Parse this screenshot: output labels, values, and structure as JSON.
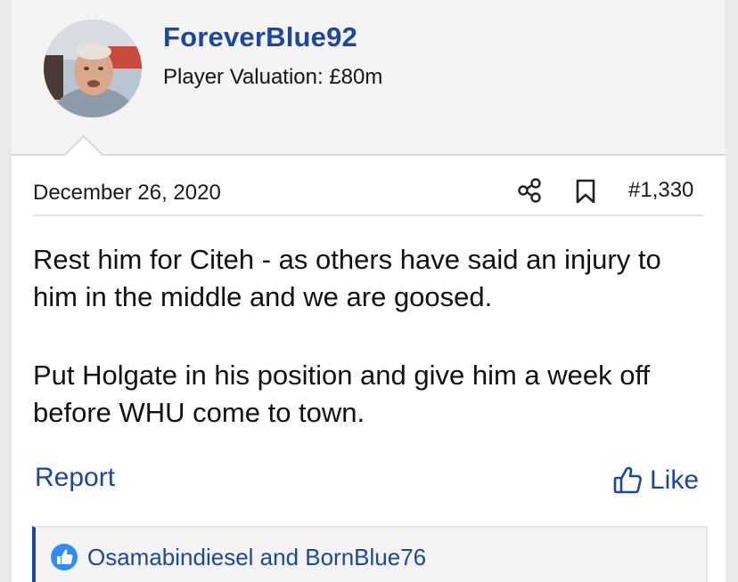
{
  "user": {
    "username": "ForeverBlue92",
    "valuation": "Player Valuation: £80m"
  },
  "post": {
    "date": "December 26, 2020",
    "number": "#1,330",
    "paragraphs": [
      "Rest him for Citeh - as others have said an injury to him in the middle and we are goosed.",
      "Put Holgate in his position and give him a week off before WHU come to town."
    ]
  },
  "actions": {
    "report_label": "Report",
    "like_label": "Like"
  },
  "reactions": {
    "text": "Osamabindiesel and BornBlue76"
  },
  "icons": {
    "share": "share-icon",
    "bookmark": "bookmark-icon",
    "like": "thumbs-up-icon",
    "reaction": "like-badge-icon"
  },
  "colors": {
    "accent": "#1b46a6",
    "header_bg": "#f4f4f5",
    "reaction_badge": "#2e8cff"
  }
}
